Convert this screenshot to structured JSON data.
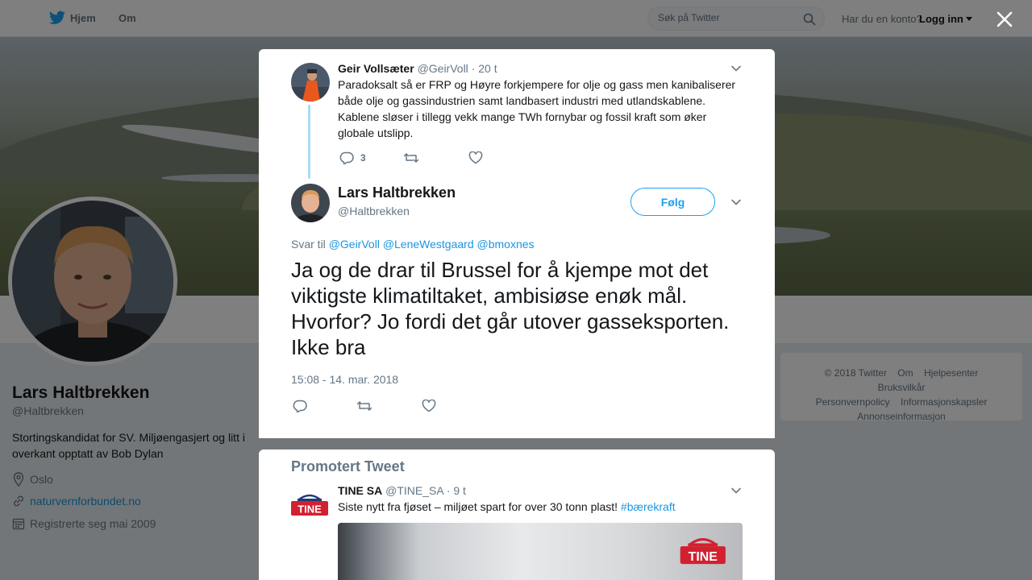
{
  "navbar": {
    "home_label": "Hjem",
    "about_label": "Om",
    "search_placeholder": "Søk på Twitter",
    "login_prompt": "Har du en konto?",
    "login_label": "Logg inn"
  },
  "profile": {
    "name": "Lars Haltbrekken",
    "handle": "@Haltbrekken",
    "bio": "Stortingskandidat for SV. Miljøengasjert og litt i overkant opptatt av Bob Dylan",
    "location": "Oslo",
    "website": "naturvernforbundet.no",
    "joined": "Registrerte seg mai 2009"
  },
  "footer": {
    "links": [
      "© 2018 Twitter",
      "Om",
      "Hjelpesenter",
      "Bruksvilkår",
      "Personvernpolicy",
      "Informasjonskapsler",
      "Annonseinformasjon"
    ]
  },
  "parent_tweet": {
    "name": "Geir Vollsæter",
    "handle": "@GeirVoll",
    "time": "· 20 t",
    "text": "Paradoksalt så er FRP og Høyre forkjempere for olje og gass men kanibaliserer både olje og gassindustrien samt landbasert industri med utlandskablene. Kablene sløser i tillegg vekk mange TWh fornybar og fossil kraft som øker globale utslipp.",
    "reply_count": "3"
  },
  "main_tweet": {
    "name": "Lars Haltbrekken",
    "handle": "@Haltbrekken",
    "follow_label": "Følg",
    "reply_prefix": "Svar til",
    "reply_to": [
      "@GeirVoll",
      "@LeneWestgaard",
      "@bmoxnes"
    ],
    "text": "Ja og de drar til Brussel for å kjempe mot det viktigste klimatiltaket, ambisiøse enøk mål. Hvorfor? Jo fordi det går utover gasseksporten. Ikke bra",
    "timestamp": "15:08 - 14. mar. 2018"
  },
  "promoted": {
    "title": "Promotert Tweet",
    "name": "TINE SA",
    "handle": "@TINE_SA",
    "time": "· 9 t",
    "text": "Siste nytt fra fjøset – miljøet spart for over 30 tonn plast!",
    "hashtag": "#bærekraft",
    "logo_text": "TINE"
  },
  "colors": {
    "accent": "#1da1f2",
    "link": "#1b95e0",
    "muted": "#657786",
    "thread_line": "#a8dcf8",
    "tine_red": "#d3202f"
  }
}
